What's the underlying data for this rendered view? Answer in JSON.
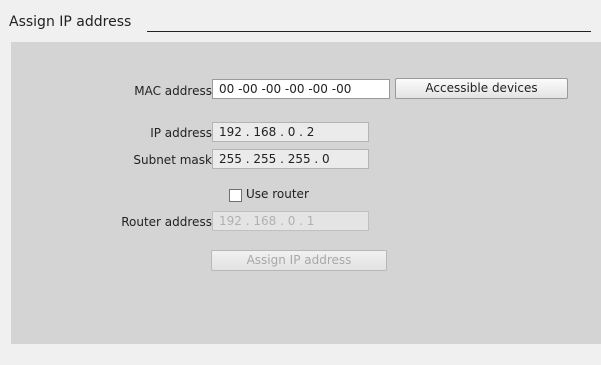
{
  "header": {
    "title": "Assign IP address"
  },
  "form": {
    "mac_label": "MAC address:",
    "mac_value": "00 -00 -00 -00 -00 -00",
    "accessible_devices_label": "Accessible devices",
    "ip_label": "IP address:",
    "ip_value": "192 . 168 . 0 . 2",
    "subnet_label": "Subnet mask:",
    "subnet_value": "255 . 255 . 255 . 0",
    "use_router_label": "Use router",
    "use_router_checked": false,
    "router_label": "Router address:",
    "router_value": "192 . 168 . 0 . 1",
    "assign_button_label": "Assign IP address"
  }
}
